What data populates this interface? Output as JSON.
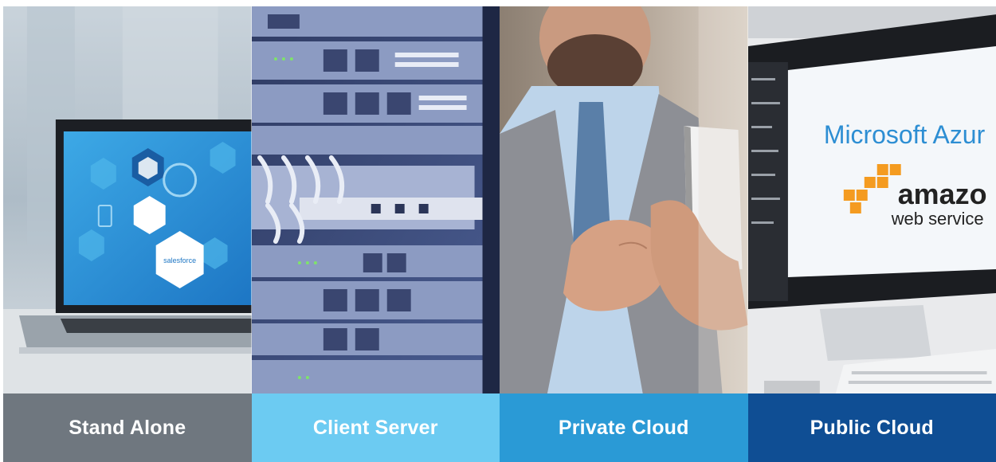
{
  "tiles": [
    {
      "label": "Stand Alone",
      "color": "#6f777f",
      "image": "laptop-salesforce",
      "screen_text": "salesforce"
    },
    {
      "label": "Client Server",
      "color": "#6ccbf2",
      "image": "server-rack"
    },
    {
      "label": "Private Cloud",
      "color": "#2a9ad6",
      "image": "man-with-phone"
    },
    {
      "label": "Public Cloud",
      "color": "#0f4e94",
      "image": "monitor-azure-aws",
      "screen_line_1": "Microsoft Azur",
      "screen_line_2": "amazo",
      "screen_line_3": "web service"
    }
  ]
}
